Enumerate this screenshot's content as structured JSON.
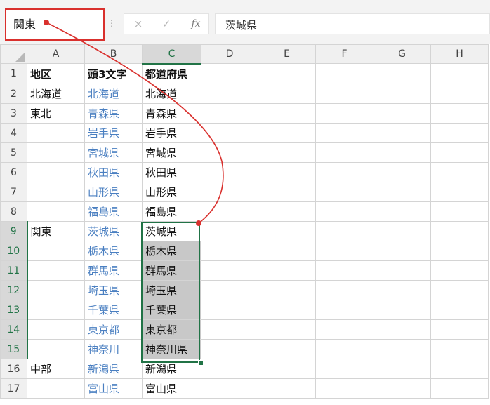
{
  "name_box": {
    "value": "関東"
  },
  "formula_bar": {
    "cancel_icon": "×",
    "enter_icon": "✓",
    "fx_label": "fx",
    "value": "茨城県"
  },
  "columns": [
    "A",
    "B",
    "C",
    "D",
    "E",
    "F",
    "G",
    "H"
  ],
  "rows": [
    {
      "n": "1",
      "a": "地区",
      "b": "頭3文字",
      "c": "都道府県"
    },
    {
      "n": "2",
      "a": "北海道",
      "b": "北海道",
      "c": "北海道"
    },
    {
      "n": "3",
      "a": "東北",
      "b": "青森県",
      "c": "青森県"
    },
    {
      "n": "4",
      "a": "",
      "b": "岩手県",
      "c": "岩手県"
    },
    {
      "n": "5",
      "a": "",
      "b": "宮城県",
      "c": "宮城県"
    },
    {
      "n": "6",
      "a": "",
      "b": "秋田県",
      "c": "秋田県"
    },
    {
      "n": "7",
      "a": "",
      "b": "山形県",
      "c": "山形県"
    },
    {
      "n": "8",
      "a": "",
      "b": "福島県",
      "c": "福島県"
    },
    {
      "n": "9",
      "a": "関東",
      "b": "茨城県",
      "c": "茨城県"
    },
    {
      "n": "10",
      "a": "",
      "b": "栃木県",
      "c": "栃木県"
    },
    {
      "n": "11",
      "a": "",
      "b": "群馬県",
      "c": "群馬県"
    },
    {
      "n": "12",
      "a": "",
      "b": "埼玉県",
      "c": "埼玉県"
    },
    {
      "n": "13",
      "a": "",
      "b": "千葉県",
      "c": "千葉県"
    },
    {
      "n": "14",
      "a": "",
      "b": "東京都",
      "c": "東京都"
    },
    {
      "n": "15",
      "a": "",
      "b": "神奈川",
      "c": "神奈川県"
    },
    {
      "n": "16",
      "a": "中部",
      "b": "新潟県",
      "c": "新潟県"
    },
    {
      "n": "17",
      "a": "",
      "b": "富山県",
      "c": "富山県"
    }
  ],
  "colors": {
    "accent": "#217346",
    "annotation": "#d9302d",
    "formula_text": "#4a7fc1"
  }
}
